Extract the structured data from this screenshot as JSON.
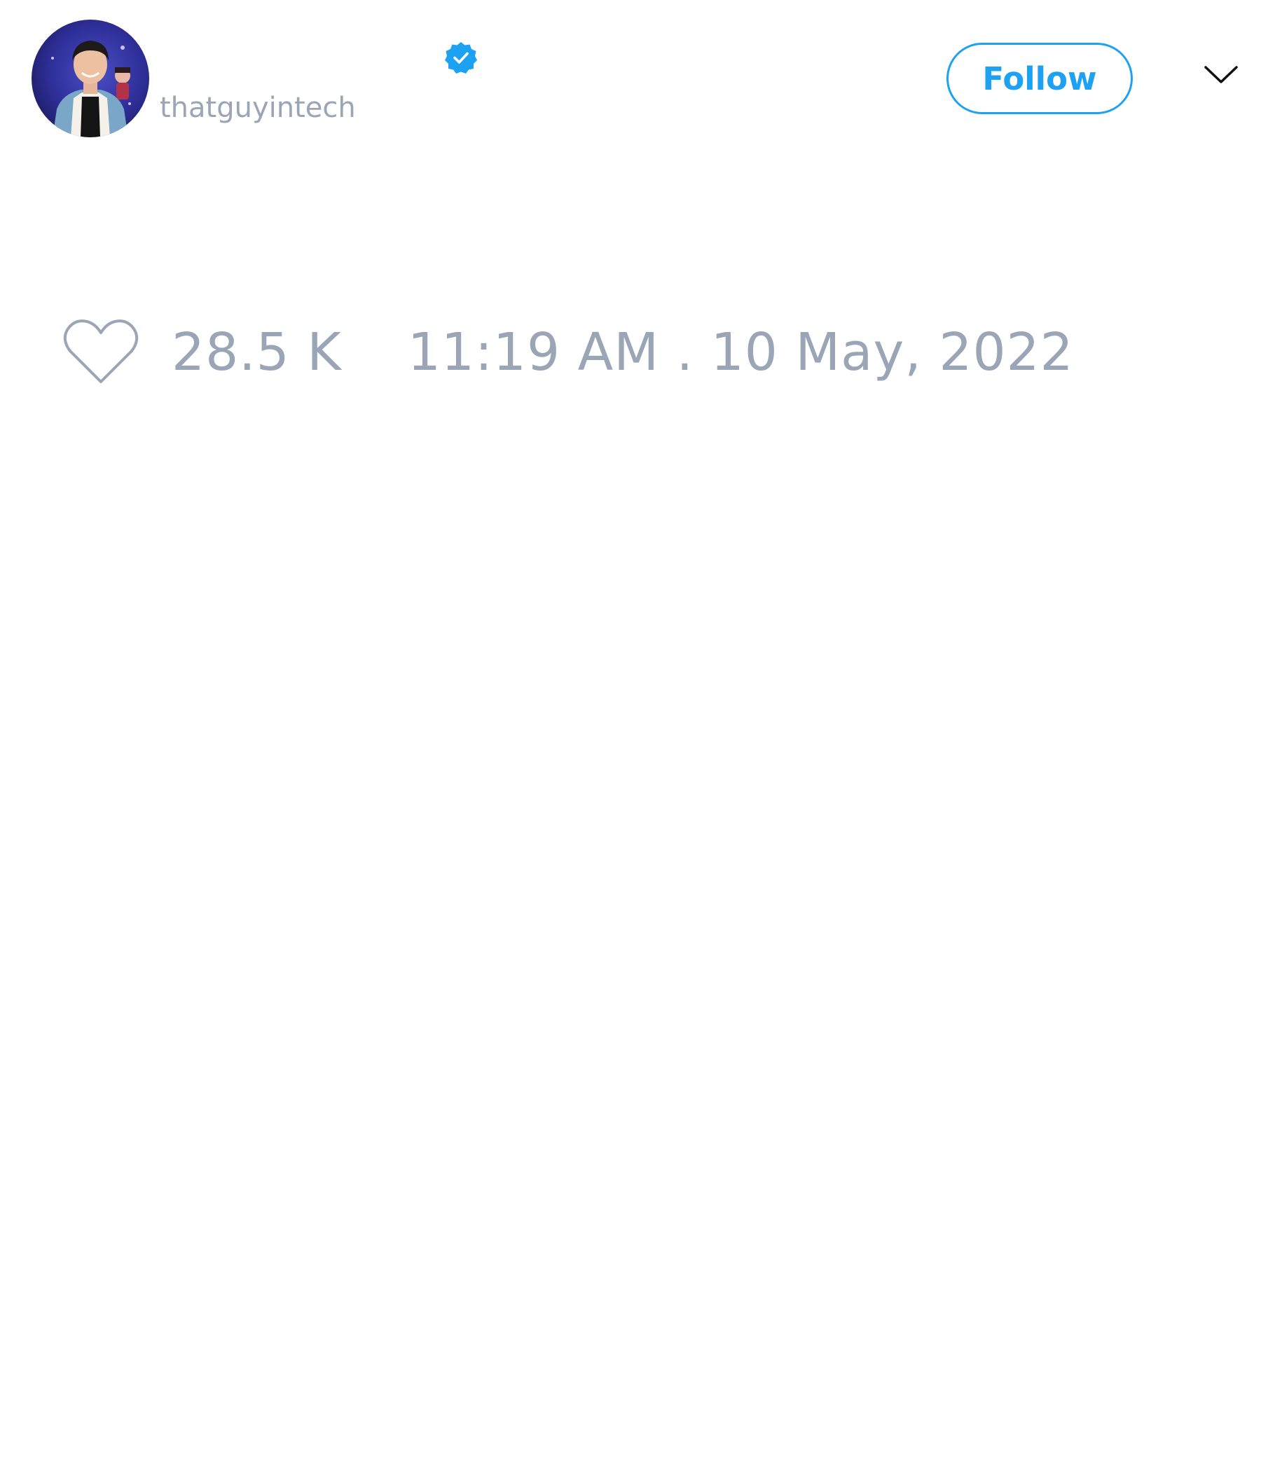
{
  "tweet": {
    "author": {
      "handle": "thatguyintech",
      "avatar": "avatar-photo",
      "verified": true,
      "verified_icon": "verified-badge-icon"
    },
    "follow_label": "Follow",
    "menu_icon": "chevron-down-icon",
    "likes": {
      "icon": "heart-icon",
      "count": "28.5 K"
    },
    "timestamp": "11:19 AM . 10 May, 2022"
  },
  "colors": {
    "accent": "#1da1f2",
    "muted_text": "#9aa5b6",
    "background": "#ffffff"
  }
}
